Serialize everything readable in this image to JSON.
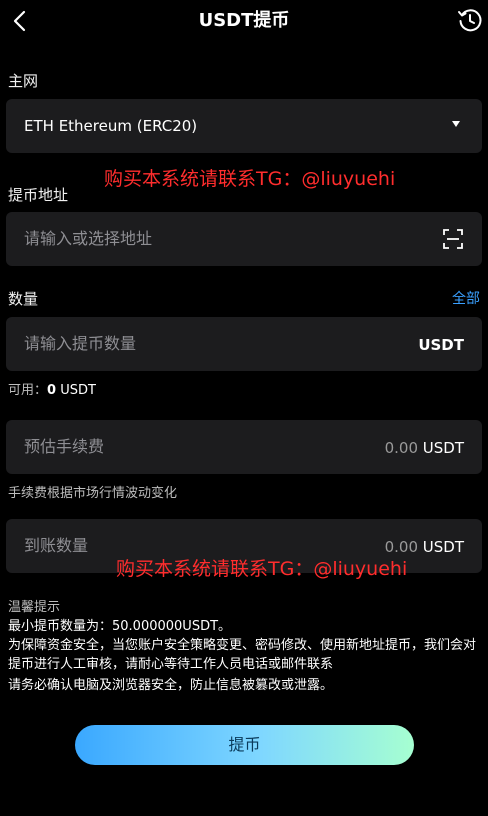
{
  "header": {
    "title": "USDT提币"
  },
  "network": {
    "label": "主网",
    "selected": "ETH Ethereum (ERC20)"
  },
  "watermark": {
    "text": "购买本系统请联系TG：@liuyuehi"
  },
  "address": {
    "label": "提币地址",
    "placeholder": "请输入或选择地址"
  },
  "amount": {
    "label": "数量",
    "all_label": "全部",
    "placeholder": "请输入提币数量",
    "unit": "USDT"
  },
  "available": {
    "label": "可用：",
    "value": "0",
    "unit": "USDT"
  },
  "fee": {
    "label": "预估手续费",
    "value": "0.00",
    "unit": "USDT",
    "note": "手续费根据市场行情波动变化"
  },
  "received": {
    "label": "到账数量",
    "value": "0.00",
    "unit": "USDT"
  },
  "tips": {
    "title": "温馨提示",
    "line1": "最小提币数量为：50.000000USDT。",
    "line2": "为保障资金安全，当您账户安全策略变更、密码修改、使用新地址提币，我们会对提币进行人工审核，请耐心等待工作人员电话或邮件联系",
    "line3": "请务必确认电脑及浏览器安全，防止信息被篡改或泄露。"
  },
  "submit": {
    "label": "提币"
  },
  "colors": {
    "accent": "#3aa0ff",
    "watermark": "#ff2d2d",
    "field_bg": "#1c1c1e"
  }
}
